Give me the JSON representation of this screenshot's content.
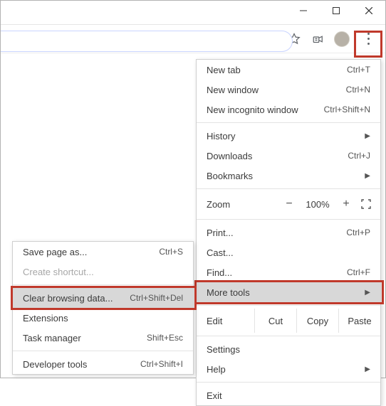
{
  "titlebar": {
    "minimize": "Minimize",
    "maximize": "Maximize",
    "close": "Close"
  },
  "toolbar": {
    "omnibox_placeholder": "",
    "star": "Bookmark this page",
    "media": "Media controls",
    "profile": "Profile",
    "menu": "Customize and control Google Chrome"
  },
  "menu": {
    "new_tab": {
      "label": "New tab",
      "shortcut": "Ctrl+T"
    },
    "new_window": {
      "label": "New window",
      "shortcut": "Ctrl+N"
    },
    "incognito": {
      "label": "New incognito window",
      "shortcut": "Ctrl+Shift+N"
    },
    "history": {
      "label": "History"
    },
    "downloads": {
      "label": "Downloads",
      "shortcut": "Ctrl+J"
    },
    "bookmarks": {
      "label": "Bookmarks"
    },
    "zoom_label": "Zoom",
    "zoom_minus": "−",
    "zoom_value": "100%",
    "zoom_plus": "+",
    "print": {
      "label": "Print...",
      "shortcut": "Ctrl+P"
    },
    "cast": {
      "label": "Cast..."
    },
    "find": {
      "label": "Find...",
      "shortcut": "Ctrl+F"
    },
    "more_tools": {
      "label": "More tools"
    },
    "edit_label": "Edit",
    "cut": "Cut",
    "copy": "Copy",
    "paste": "Paste",
    "settings": {
      "label": "Settings"
    },
    "help": {
      "label": "Help"
    },
    "exit": {
      "label": "Exit"
    }
  },
  "submenu": {
    "save_page": {
      "label": "Save page as...",
      "shortcut": "Ctrl+S"
    },
    "create_shortcut": {
      "label": "Create shortcut..."
    },
    "clear_data": {
      "label": "Clear browsing data...",
      "shortcut": "Ctrl+Shift+Del"
    },
    "extensions": {
      "label": "Extensions"
    },
    "task_manager": {
      "label": "Task manager",
      "shortcut": "Shift+Esc"
    },
    "dev_tools": {
      "label": "Developer tools",
      "shortcut": "Ctrl+Shift+I"
    }
  }
}
